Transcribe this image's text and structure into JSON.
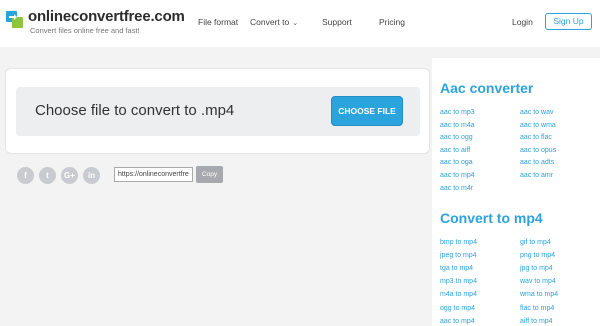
{
  "brand": {
    "name": "onlineconvertfree.com",
    "tagline": "Convert files online free and fast!"
  },
  "nav": {
    "items": [
      "File format",
      "Convert to",
      "Support",
      "Pricing"
    ],
    "login": "Login",
    "signup": "Sign Up"
  },
  "converter": {
    "prompt": "Choose file to convert to .mp4",
    "button": "CHOOSE FILE"
  },
  "share": {
    "networks": [
      "f",
      "t",
      "G+",
      "in"
    ],
    "url": "https://onlineconvertfre",
    "copy_label": "Copy"
  },
  "sidebar": {
    "aac": {
      "title": "Aac converter",
      "links": [
        "aac to mp3",
        "aac to wav",
        "aac to m4a",
        "aac to wma",
        "aac to ogg",
        "aac to flac",
        "aac to aiff",
        "aac to opus",
        "aac to oga",
        "aac to adts",
        "aac to mp4",
        "aac to amr",
        "aac to m4r"
      ]
    },
    "mp4": {
      "title": "Convert to mp4",
      "links": [
        "bmp to mp4",
        "gif to mp4",
        "jpeg to mp4",
        "png to mp4",
        "tga to mp4",
        "jpg to mp4",
        "mp3 to mp4",
        "wav to mp4",
        "m4a to mp4",
        "wma to mp4",
        "ogg to mp4",
        "flac to mp4",
        "aac to mp4",
        "aiff to mp4"
      ]
    }
  },
  "colors": {
    "accent": "#2ba3dd",
    "background": "#f3f3f3",
    "dropzone": "#eceef0",
    "social": "#c8cbcf"
  }
}
